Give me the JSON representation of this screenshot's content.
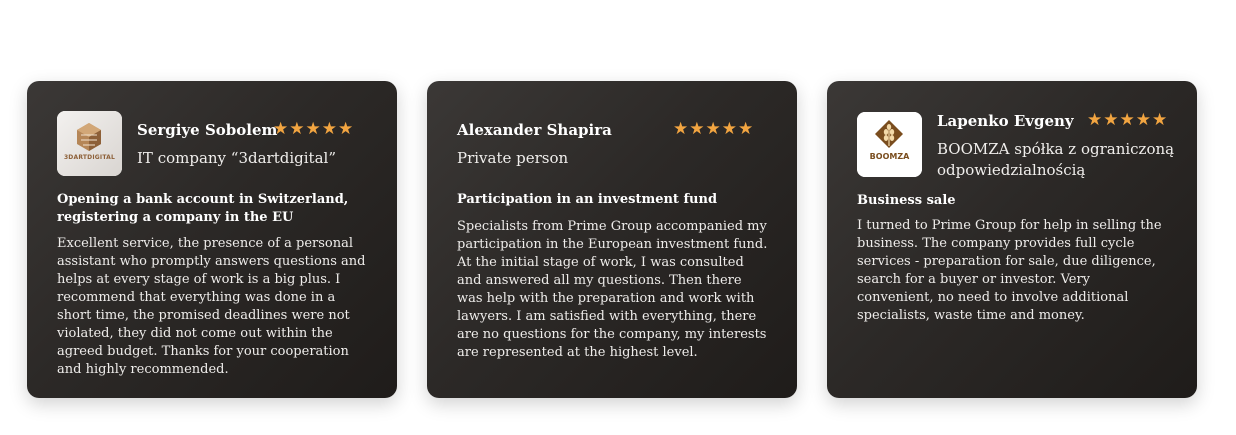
{
  "colors": {
    "card_background": "#2c2927",
    "star": "#f2a541",
    "text": "#ffffff",
    "boomza_brown": "#7a4d1e",
    "dartdigital_brown": "#a0724a"
  },
  "reviews": [
    {
      "name": "Sergiye Sobolem",
      "rating": 5,
      "stars": "★★★★★",
      "company": "IT company “3dartdigital”",
      "logo_icon": "3dartdigital-logo-icon",
      "logo_text": "3DARTDIGITAL",
      "subject": "Opening a bank account in Switzerland, registering a company in the EU",
      "text": "Excellent service, the presence of a personal assistant who promptly answers questions and helps at every stage of work is a big plus. I recommend that everything was done in a short time, the promised deadlines were not violated, they did not come out within the agreed budget. Thanks for your cooperation and highly recommended."
    },
    {
      "name": "Alexander Shapira",
      "rating": 5,
      "stars": "★★★★★",
      "company": "Private person",
      "subject": "Participation in an investment fund",
      "text": "Specialists from Prime Group accompanied my participation in the European investment fund. At the initial stage of work, I was consulted and answered all my questions. Then there was help with the preparation and work with lawyers. I am satisfied with everything, there are no questions for the company, my interests are represented at the highest level."
    },
    {
      "name": "Lapenko Evgeny",
      "rating": 5,
      "stars": "★★★★★",
      "company": "BOOMZA spółka z ograniczoną odpowiedzialnością",
      "logo_icon": "boomza-logo-icon",
      "logo_text": "BOOMZA",
      "subject": "Business sale",
      "text": "I turned to Prime Group for help in selling the business. The company provides full cycle services - preparation for sale, due diligence, search for a buyer or investor. Very convenient, no need to involve additional specialists, waste time and money."
    }
  ]
}
